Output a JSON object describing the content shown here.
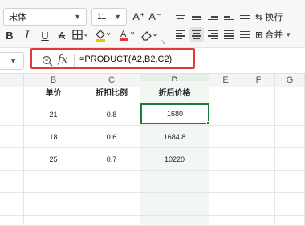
{
  "toolbar": {
    "font_name": "宋体",
    "font_size": "11",
    "grow_font": "A⁺",
    "shrink_font": "A⁻",
    "bold": "B",
    "italic": "I",
    "underline": "U",
    "strike": "A",
    "font_color": "A",
    "wrap_label": "换行",
    "merge_label": "合并",
    "colors": {
      "highlight": "#f2c200",
      "font_color": "#e03a3a"
    }
  },
  "formula_bar": {
    "fx": "fx",
    "formula": "=PRODUCT(A2,B2,C2)"
  },
  "columns": [
    "B",
    "C",
    "D",
    "E",
    "F",
    "G"
  ],
  "selected_column": "D",
  "rows": [
    [
      "单价",
      "折扣比例",
      "折后价格"
    ],
    [
      "21",
      "0.8",
      "1680"
    ],
    [
      "18",
      "0.6",
      "1684.8"
    ],
    [
      "25",
      "0.7",
      "10220"
    ]
  ]
}
